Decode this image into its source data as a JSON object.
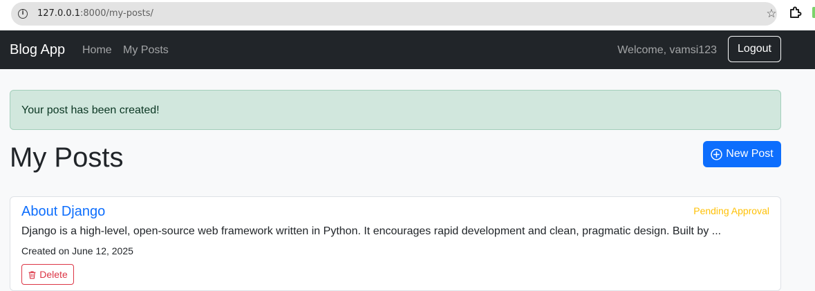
{
  "browser": {
    "url_host": "127.0.0.1",
    "url_rest": ":8000/my-posts/"
  },
  "navbar": {
    "brand": "Blog App",
    "links": [
      {
        "label": "Home"
      },
      {
        "label": "My Posts"
      }
    ],
    "welcome": "Welcome, vamsi123",
    "logout_label": "Logout"
  },
  "alert": {
    "message": "Your post has been created!"
  },
  "page": {
    "title": "My Posts",
    "new_post_label": "New Post"
  },
  "posts": [
    {
      "title": "About Django",
      "status": "Pending Approval",
      "excerpt": "Django is a high-level, open-source web framework written in Python. It encourages rapid development and clean, pragmatic design. Built by ...",
      "created": "Created on June 12, 2025",
      "delete_label": "Delete"
    }
  ],
  "colors": {
    "navbar_bg": "#212529",
    "primary": "#0d6efd",
    "warning": "#ffc107",
    "danger": "#dc3545",
    "success_bg": "#d1e7dd"
  },
  "icons": {
    "site_info": "info-circle-icon",
    "bookmark": "star-icon",
    "extensions": "puzzle-icon",
    "new_post": "plus-circle-icon",
    "delete": "trash-icon"
  }
}
